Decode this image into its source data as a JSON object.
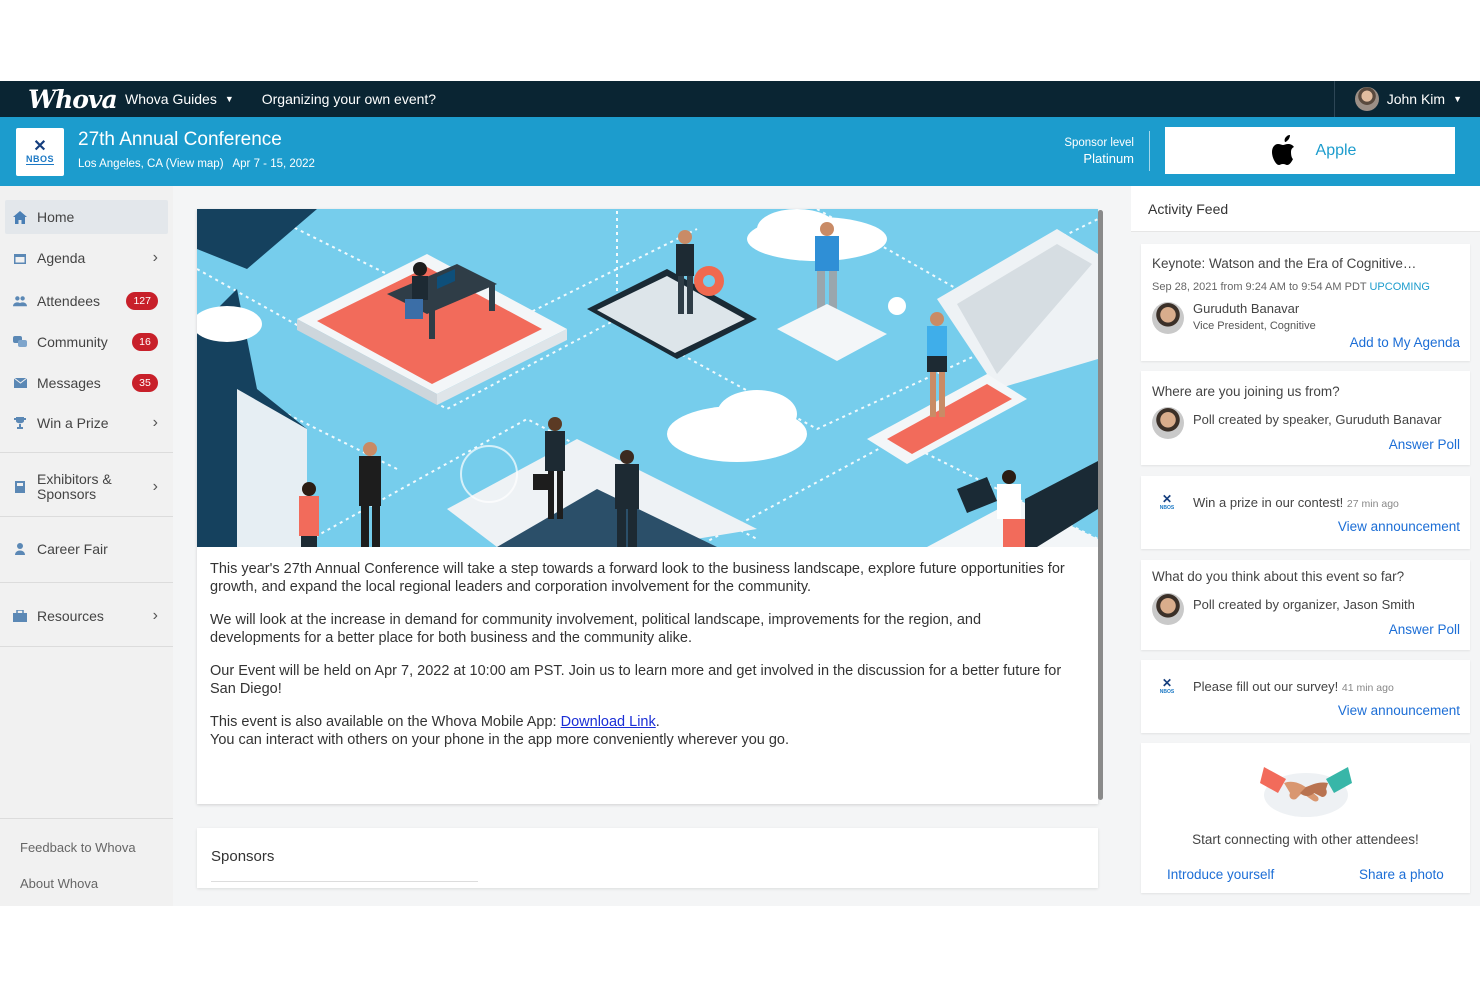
{
  "topbar": {
    "logo": "Whova",
    "guides_label": "Whova Guides",
    "organize_label": "Organizing your own event?",
    "user_name": "John Kim"
  },
  "event": {
    "logo_text": "NBOS",
    "title": "27th Annual Conference",
    "location": "Los Angeles, CA (View map)",
    "dates": "Apr 7 - 15, 2022",
    "sponsor_level_label": "Sponsor level",
    "sponsor_level": "Platinum",
    "sponsor_name": "Apple"
  },
  "sidebar": {
    "items": [
      {
        "label": "Home",
        "icon": "home-icon"
      },
      {
        "label": "Agenda",
        "icon": "calendar-icon"
      },
      {
        "label": "Attendees",
        "icon": "people-icon",
        "badge": "127"
      },
      {
        "label": "Community",
        "icon": "chat-icon",
        "badge": "16"
      },
      {
        "label": "Messages",
        "icon": "envelope-icon",
        "badge": "35"
      },
      {
        "label": "Win a Prize",
        "icon": "trophy-icon"
      },
      {
        "label_line1": "Exhibitors &",
        "label_line2": "Sponsors",
        "icon": "booth-icon"
      },
      {
        "label": "Career Fair",
        "icon": "person-icon"
      },
      {
        "label": "Resources",
        "icon": "briefcase-icon"
      }
    ],
    "footer": {
      "feedback": "Feedback to Whova",
      "about": "About Whova"
    }
  },
  "main": {
    "paragraphs": [
      "This year's 27th Annual Conference will take a step towards a forward look to the business landscape, explore future opportunities for growth, and expand the local regional leaders and corporation involvement for the community.",
      "We will look at the increase in demand for community involvement, political landscape, improvements for the region, and developments for a better place for both business and the community alike.",
      "Our Event will be held on Apr 7, 2022 at 10:00 am PST. Join us to learn more and get involved in the discussion for a better future for San Diego!"
    ],
    "app_line_prefix": "This event is also available on the Whova Mobile App: ",
    "download_link": "Download Link",
    "app_line_suffix": ".",
    "app_line2": "You can interact with others on your phone in the app more conveniently wherever you go.",
    "sponsors_title": "Sponsors"
  },
  "feed": {
    "title": "Activity Feed",
    "session": {
      "title": "Keynote: Watson and the Era of Cognitive…",
      "time": "Sep 28, 2021 from 9:24 AM to 9:54 AM PDT",
      "status": "UPCOMING",
      "speaker": "Guruduth Banavar",
      "speaker_title": "Vice President, Cognitive",
      "action": "Add to My Agenda"
    },
    "poll1": {
      "question": "Where are you joining us from?",
      "by": "Poll created by speaker, Guruduth Banavar",
      "action": "Answer Poll"
    },
    "announce1": {
      "text": "Win a prize in our contest!",
      "ago": "27 min ago",
      "action": "View announcement"
    },
    "poll2": {
      "question": "What do you think about this event so far?",
      "by": "Poll created by organizer, Jason Smith",
      "action": "Answer Poll"
    },
    "announce2": {
      "text": "Please fill out our survey!",
      "ago": "41 min ago",
      "action": "View announcement"
    },
    "connect": {
      "text": "Start connecting with other attendees!",
      "introduce": "Introduce yourself",
      "share": "Share a photo"
    }
  },
  "colors": {
    "topbar": "#0a2533",
    "brand_blue": "#1c9ccd",
    "badge_red": "#c8202a",
    "link_blue": "#1c6ed6"
  }
}
